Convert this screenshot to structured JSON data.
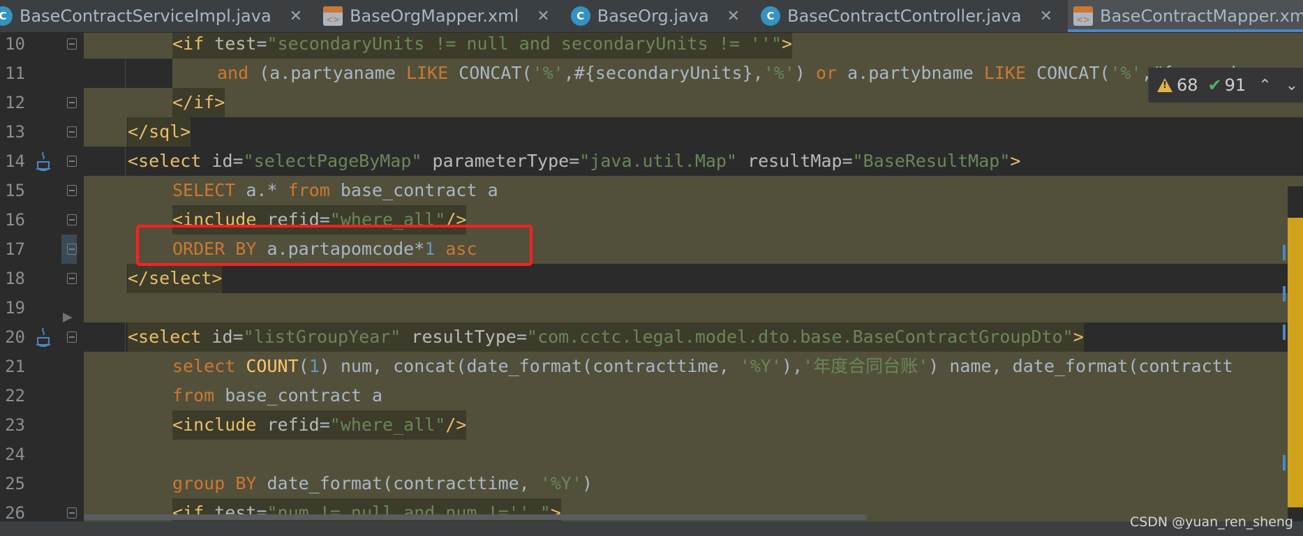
{
  "tabs": [
    {
      "label": "BaseContractServiceImpl.java",
      "icon": "class-icon",
      "active": false
    },
    {
      "label": "BaseOrgMapper.xml",
      "icon": "xml-file-icon",
      "active": false
    },
    {
      "label": "BaseOrg.java",
      "icon": "class-icon",
      "active": false
    },
    {
      "label": "BaseContractController.java",
      "icon": "class-icon",
      "active": false
    },
    {
      "label": "BaseContractMapper.xml",
      "icon": "xml-file-icon",
      "active": true
    }
  ],
  "inspection": {
    "warnings": "68",
    "weak_warnings": "91"
  },
  "lines": [
    {
      "n": "10"
    },
    {
      "n": "11"
    },
    {
      "n": "12"
    },
    {
      "n": "13"
    },
    {
      "n": "14"
    },
    {
      "n": "15"
    },
    {
      "n": "16"
    },
    {
      "n": "17"
    },
    {
      "n": "18"
    },
    {
      "n": "19"
    },
    {
      "n": "20"
    },
    {
      "n": "21"
    },
    {
      "n": "22"
    },
    {
      "n": "23"
    },
    {
      "n": "24"
    },
    {
      "n": "25"
    },
    {
      "n": "26"
    }
  ],
  "code": {
    "l10": {
      "t1": "<if ",
      "a": "test",
      "eq": "=",
      "s": "\"secondaryUnits != null and secondaryUnits != ''\"",
      "t2": ">"
    },
    "l11": {
      "kw1": "and",
      "p1": " (a.partyaname ",
      "kw2": "LIKE",
      "p2": " CONCAT(",
      "s1": "'%'",
      "p3": ",#{secondaryUnits},",
      "s2": "'%'",
      "p4": ") ",
      "kw3": "or",
      "p5": " a.partybname ",
      "kw4": "LIKE",
      "p6": " CONCAT(",
      "s3": "'%'",
      "p7": ",#{seconda"
    },
    "l12": {
      "t": "</if>"
    },
    "l13": {
      "t": "</sql>"
    },
    "l14": {
      "t1": "<select ",
      "a1": "id",
      "eq1": "=",
      "s1": "\"selectPageByMap\"",
      "a2": " parameterType",
      "eq2": "=",
      "s2": "\"java.util.Map\"",
      "a3": " resultMap",
      "eq3": "=",
      "s3": "\"BaseResultMap\"",
      "t2": ">"
    },
    "l15": {
      "kw1": "SELECT",
      "p1": " a.* ",
      "kw2": "from",
      "p2": " base_contract a"
    },
    "l16": {
      "t1": "<include ",
      "a": "refid",
      "eq": "=",
      "s": "\"where_all\"",
      "t2": "/>"
    },
    "l17": {
      "kw1": "ORDER BY",
      "p1": " a.partapomcode*",
      "n": "1",
      "kw2": " asc"
    },
    "l18": {
      "t": "</select>"
    },
    "l20": {
      "t1": "<select ",
      "a1": "id",
      "eq1": "=",
      "s1": "\"listGroupYear\"",
      "a2": " resultType",
      "eq2": "=",
      "s2": "\"com.cctc.legal.model.dto.base.BaseContractGroupDto\"",
      "t2": ">"
    },
    "l21": {
      "kw1": "select",
      "fn": " COUNT",
      "p1": "(",
      "n": "1",
      "p2": ") num, concat(date_format(contracttime, ",
      "s1": "'%Y'",
      "p3": "),",
      "s2": "'年度合同台账'",
      "p4": ") name, date_format(contractt"
    },
    "l22": {
      "kw1": "from",
      "p1": " base_contract a"
    },
    "l23": {
      "t1": "<include ",
      "a": "refid",
      "eq": "=",
      "s": "\"where_all\"",
      "t2": "/>"
    },
    "l25": {
      "kw1": "group",
      "kw2": " BY",
      "p1": " date_format(contracttime, ",
      "s1": "'%Y'",
      "p2": ")"
    },
    "l26": {
      "t1": "<if ",
      "a": "test",
      "eq": "=",
      "s": "\"num != null and num !='' \"",
      "t2": ">"
    }
  },
  "watermark": "CSDN @yuan_ren_sheng",
  "colors": {
    "background": "#2b2b2b",
    "keyword": "#cc7832",
    "string": "#6a8759",
    "tag": "#e8bf6a",
    "highlight_box": "#ff1f1f"
  }
}
